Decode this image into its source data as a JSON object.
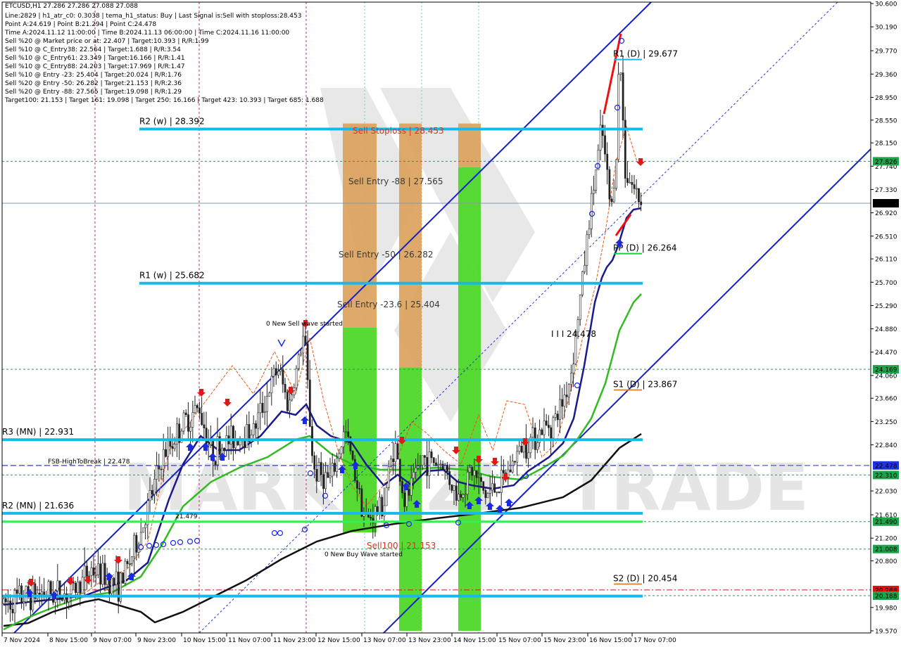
{
  "header": {
    "symbol": "ETCUSD,H1  27.286 27.286 27.088 27.088",
    "lines": [
      "Line:2829  |  h1_atr_c0: 0.3038  |  tema_h1_status: Buy  |  Last Signal is:Sell with stoploss:28.453",
      "Point A:24.619  |  Point B:21.294  |  Point C:24.478",
      "Time A:2024.11.12 11:00:00  |  Time B:2024.11.13 06:00:00  |  Time C:2024.11.16 11:00:00",
      "Sell %20 @ Market price or at: 22.407  |  Target:10.393  |  R/R:1.99",
      "Sell %10 @ C_Entry38: 22.564  |  Target:1.688  |  R/R:3.54",
      "Sell %10 @ C_Entry61: 23.349  |  Target:16.166  |  R/R:1.41",
      "Sell %10 @ C_Entry88: 24.203  |  Target:17.969  |  R/R:1.47",
      "Sell %10 @ Entry -23: 25.404  |  Target:20.024  |  R/R:1.76",
      "Sell %20 @ Entry -50: 26.282  |  Target:21.153  |  R/R:2.36",
      "Sell %20 @ Entry -88: 27.565  |  Target:19.098  |  R/R:1.29",
      "Target100: 21.153  |  Target 161: 19.098  |  Target 250: 16.166  |  Target 423: 10.393  |  Target 685: 1.688"
    ]
  },
  "watermark": {
    "left": "MARKETZI",
    "right": "TRADE"
  },
  "chart_data": {
    "type": "candlestick",
    "symbol": "ETCUSD",
    "timeframe": "H1",
    "ylim": [
      19.57,
      30.6
    ],
    "y_ticks": [
      "30.600",
      "30.190",
      "29.770",
      "29.360",
      "28.950",
      "28.550",
      "28.150",
      "27.740",
      "27.330",
      "26.920",
      "26.510",
      "26.110",
      "25.700",
      "25.290",
      "24.880",
      "24.470",
      "24.060",
      "23.660",
      "23.250",
      "22.840",
      "22.030",
      "21.610",
      "21.200",
      "20.800",
      "19.980",
      "19.570"
    ],
    "x_ticks": [
      "7 Nov 2024",
      "8 Nov 15:00",
      "9 Nov 07:00",
      "9 Nov 23:00",
      "10 Nov 15:00",
      "11 Nov 07:00",
      "11 Nov 23:00",
      "12 Nov 15:00",
      "13 Nov 07:00",
      "13 Nov 23:00",
      "14 Nov 15:00",
      "15 Nov 07:00",
      "15 Nov 23:00",
      "16 Nov 15:00",
      "17 Nov 07:00"
    ],
    "price_tags": [
      {
        "value": 27.826,
        "label": "27.826",
        "color": "#1fa34a"
      },
      {
        "value": 27.088,
        "label": "27.088",
        "color": "#000000"
      },
      {
        "value": 24.169,
        "label": "24.169",
        "color": "#1fa34a"
      },
      {
        "value": 22.478,
        "label": "22.478",
        "color": "#2233dd"
      },
      {
        "value": 22.31,
        "label": "22.310",
        "color": "#1fa34a"
      },
      {
        "value": 21.49,
        "label": "21.490",
        "color": "#1fa34a"
      },
      {
        "value": 21.008,
        "label": "21.008",
        "color": "#1fa34a"
      },
      {
        "value": 20.288,
        "label": "20.288",
        "color": "#dd1111"
      },
      {
        "value": 20.188,
        "label": "20.188",
        "color": "#1fa34a"
      }
    ],
    "pivot_levels": [
      {
        "label": "R2 (w) | 28.392",
        "value": 28.392,
        "color": "#1ab8e8"
      },
      {
        "label": "R1 (w) | 25.682",
        "value": 25.682,
        "color": "#1ab8e8"
      },
      {
        "label": "R3 (MN) | 22.931",
        "value": 22.931,
        "color": "#1ab8e8"
      },
      {
        "label": "R2 (MN) | 21.636",
        "value": 21.636,
        "color": "#1ab8e8"
      },
      {
        "label": "",
        "value": 20.18,
        "color": "#1ab8e8"
      }
    ],
    "daily_levels": [
      {
        "label": "R1 (D) | 29.677",
        "value": 29.677,
        "color": "#1ab8e8"
      },
      {
        "label": "PP (D) | 26.264",
        "value": 26.264,
        "color": "#22cc44"
      },
      {
        "label": "S1 (D) | 23.867",
        "value": 23.867,
        "color": "#e08a30"
      },
      {
        "label": "S2 (D) | 20.454",
        "value": 20.454,
        "color": "#e08a30"
      }
    ],
    "fsb_level": {
      "label": "FSB-HighToBreak | 22.478",
      "value": 22.478
    },
    "zone_labels": [
      {
        "text": "Sell Stoploss | 28.453",
        "value": 28.453,
        "color": "#e03020"
      },
      {
        "text": "Sell Entry -88 | 27.565",
        "value": 27.565,
        "color": "#3a3a3a"
      },
      {
        "text": "Sell Entry -50 | 26.282",
        "value": 26.282,
        "color": "#3a3a3a"
      },
      {
        "text": "Sell Entry -23.6 | 25.404",
        "value": 25.404,
        "color": "#3a3a3a"
      },
      {
        "text": "I I I 24.478",
        "value": 24.478,
        "color": "#000000"
      },
      {
        "text": "Sell100 | 21.153",
        "value": 21.153,
        "color": "#e03020"
      }
    ],
    "annotations": [
      {
        "text": "0 New Sell wave started",
        "color": "#000000"
      },
      {
        "text": "0 New Buy Wave started",
        "color": "#2233dd"
      },
      {
        "text": "21.479",
        "value": 21.479,
        "color": "#000000"
      }
    ],
    "current_price": 27.088
  }
}
